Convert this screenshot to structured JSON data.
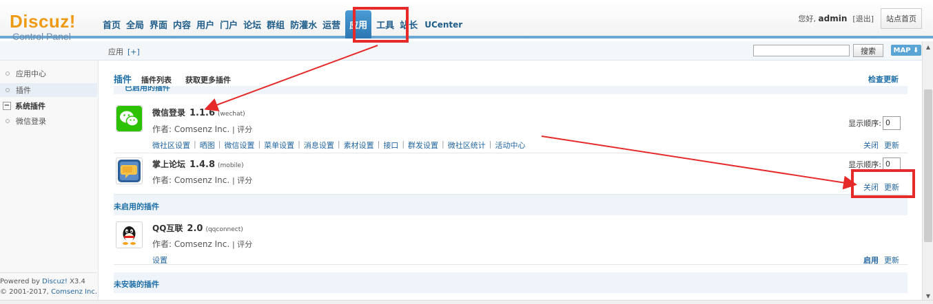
{
  "logo": {
    "brand": "Discuz!",
    "subtitle": "Control Panel"
  },
  "nav": {
    "items": [
      {
        "label": "首页"
      },
      {
        "label": "全局"
      },
      {
        "label": "界面"
      },
      {
        "label": "内容"
      },
      {
        "label": "用户"
      },
      {
        "label": "门户"
      },
      {
        "label": "论坛"
      },
      {
        "label": "群组"
      },
      {
        "label": "防灌水"
      },
      {
        "label": "运营"
      },
      {
        "label": "应用",
        "active": true
      },
      {
        "label": "工具"
      },
      {
        "label": "站长"
      },
      {
        "label": "UCenter"
      }
    ]
  },
  "header": {
    "greeting": "您好,",
    "username": "admin",
    "logout": "[退出]",
    "home_button": "站点首页"
  },
  "subbar": {
    "breadcrumb": "应用",
    "add": "[+]",
    "search_button": "搜索",
    "map_button": "MAP ⬇"
  },
  "sidebar": {
    "items": [
      {
        "label": "应用中心"
      },
      {
        "label": "插件",
        "selected": true
      }
    ],
    "group": {
      "toggle": "−",
      "label": "系统插件"
    },
    "group_items": [
      {
        "label": "微信登录"
      }
    ],
    "footer": {
      "powered": "Powered by",
      "product": "Discuz!",
      "version": "X3.4",
      "copyright": "© 2001-2017,",
      "company": "Comsenz Inc."
    }
  },
  "main": {
    "title": "插件",
    "tabs": [
      {
        "label": "插件列表"
      },
      {
        "label": "获取更多插件"
      }
    ],
    "check_update": "检查更新",
    "clipped_section": "已启用的插件",
    "enabled_plugins": [
      {
        "icon": "wechat-icon",
        "name": "微信登录",
        "version": "1.1.6",
        "id": "(wechat)",
        "author": "作者: Comsenz Inc.",
        "rate": "| 评分",
        "links": [
          "微社区设置",
          "晒图",
          "微信设置",
          "菜单设置",
          "消息设置",
          "素材设置",
          "接口",
          "群发设置",
          "微社区统计",
          "活动中心"
        ],
        "order_label": "显示顺序:",
        "order_value": "0",
        "actions": [
          "关闭",
          "更新"
        ]
      },
      {
        "icon": "mobile-forum-icon",
        "name": "掌上论坛",
        "version": "1.4.8",
        "id": "(mobile)",
        "author": "作者: Comsenz Inc.",
        "rate": "| 评分",
        "order_label": "显示顺序:",
        "order_value": "0",
        "actions": [
          "关闭",
          "更新"
        ]
      }
    ],
    "disabled_section": "未启用的插件",
    "disabled_plugins": [
      {
        "icon": "qq-icon",
        "name": "QQ互联",
        "version": "2.0",
        "id": "(qqconnect)",
        "author": "作者: Comsenz Inc.",
        "rate": "| 评分",
        "links": [
          "设置"
        ],
        "actions": [
          "启用",
          "更新"
        ]
      }
    ],
    "uninstalled_section": "未安装的插件"
  },
  "colors": {
    "accent": "#1e6ea7",
    "logo": "#ef9a15",
    "highlight": "#e62a2a",
    "wechat": "#2dc100"
  }
}
